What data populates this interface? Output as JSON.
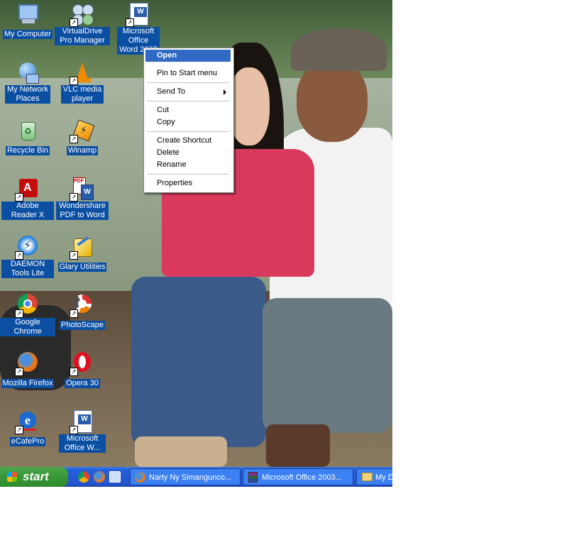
{
  "desktop_icons": [
    {
      "label": "My Computer",
      "icon": "my-computer-icon"
    },
    {
      "label": "VirtualDrive Pro Manager",
      "icon": "virtualdrive-icon"
    },
    {
      "label": "Microsoft Office Word 2007",
      "icon": "word-icon"
    },
    {
      "label": "My Network Places",
      "icon": "network-places-icon"
    },
    {
      "label": "VLC media player",
      "icon": "vlc-icon"
    },
    {
      "label": "Recycle Bin",
      "icon": "recycle-bin-icon"
    },
    {
      "label": "Winamp",
      "icon": "winamp-icon"
    },
    {
      "label": "Adobe Reader X",
      "icon": "adobe-reader-icon"
    },
    {
      "label": "Wondershare PDF to Word",
      "icon": "wondershare-icon"
    },
    {
      "label": "DAEMON Tools Lite",
      "icon": "daemon-tools-icon"
    },
    {
      "label": "Glary Utilities",
      "icon": "glary-utilities-icon"
    },
    {
      "label": "Google Chrome",
      "icon": "chrome-icon"
    },
    {
      "label": "PhotoScape",
      "icon": "photoscape-icon"
    },
    {
      "label": "Mozilla Firefox",
      "icon": "firefox-icon"
    },
    {
      "label": "Opera 30",
      "icon": "opera-icon"
    },
    {
      "label": "eCafePro",
      "icon": "ecafepro-icon"
    },
    {
      "label": "Microsoft Office W...",
      "icon": "word-icon"
    }
  ],
  "context_menu": {
    "open": "Open",
    "pin": "Pin to Start menu",
    "send_to": "Send To",
    "cut": "Cut",
    "copy": "Copy",
    "create_shortcut": "Create Shortcut",
    "delete": "Delete",
    "rename": "Rename",
    "properties": "Properties"
  },
  "taskbar": {
    "start": "start",
    "quick_launch": [
      "chrome-icon",
      "firefox-icon",
      "show-desktop-icon"
    ],
    "tasks": [
      {
        "label": "Narty Ny Simanguncо...",
        "icon": "firefox-icon"
      },
      {
        "label": "Microsoft Office 2003...",
        "icon": "winrar-icon"
      },
      {
        "label": "My D",
        "icon": "folder-icon"
      }
    ]
  },
  "colors": {
    "selection": "#316ac5",
    "icon_label_bg": "#0b4fa3",
    "taskbar": "#245edb",
    "start": "#3b9a3b"
  }
}
